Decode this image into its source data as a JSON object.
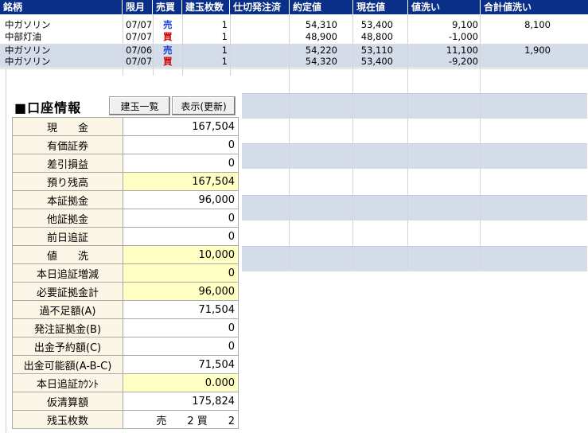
{
  "header": {
    "columns": [
      "銘柄",
      "限月",
      "売買",
      "建玉枚数",
      "仕切発注済",
      "約定値",
      "現在値",
      "値洗い",
      "合計値洗い"
    ]
  },
  "positions": [
    {
      "name": "中ガソリン",
      "month": "07/07",
      "side": "売",
      "side_type": "sell",
      "qty": "1",
      "order": "",
      "fill": "54,310",
      "current": "53,400",
      "mtm": "9,100",
      "total": "8,100"
    },
    {
      "name": "中部灯油",
      "month": "07/07",
      "side": "買",
      "side_type": "buy",
      "qty": "1",
      "order": "",
      "fill": "48,900",
      "current": "48,800",
      "mtm": "-1,000",
      "total": ""
    },
    {
      "name": "中ガソリン",
      "month": "07/06",
      "side": "売",
      "side_type": "sell",
      "qty": "1",
      "order": "",
      "fill": "54,220",
      "current": "53,110",
      "mtm": "11,100",
      "total": "1,900"
    },
    {
      "name": "中ガソリン",
      "month": "07/07",
      "side": "買",
      "side_type": "buy",
      "qty": "1",
      "order": "",
      "fill": "54,320",
      "current": "53,400",
      "mtm": "-9,200",
      "total": ""
    }
  ],
  "account": {
    "title": "■口座情報",
    "buttons": {
      "positions": "建玉一覧",
      "refresh": "表示(更新)"
    },
    "rows": [
      {
        "label": "現　　金",
        "value": "167,504",
        "highlight": false
      },
      {
        "label": "有価証券",
        "value": "0",
        "highlight": false
      },
      {
        "label": "差引損益",
        "value": "0",
        "highlight": false
      },
      {
        "label": "預り残高",
        "value": "167,504",
        "highlight": true
      },
      {
        "label": "本証拠金",
        "value": "96,000",
        "highlight": false
      },
      {
        "label": "他証拠金",
        "value": "0",
        "highlight": false
      },
      {
        "label": "前日追証",
        "value": "0",
        "highlight": false
      },
      {
        "label": "値　　洗",
        "value": "10,000",
        "highlight": true
      },
      {
        "label": "本日追証増減",
        "value": "0",
        "highlight": true
      },
      {
        "label": "必要証拠金計",
        "value": "96,000",
        "highlight": true
      },
      {
        "label": "過不足額(A)",
        "value": "71,504",
        "highlight": false
      },
      {
        "label": "発注証拠金(B)",
        "value": "0",
        "highlight": false
      },
      {
        "label": "出金予約額(C)",
        "value": "0",
        "highlight": false
      },
      {
        "label": "出金可能額(A-B-C)",
        "value": "71,504",
        "highlight": false
      },
      {
        "label": "本日追証ｶｳﾝﾄ",
        "value": "0.000",
        "highlight": true
      },
      {
        "label": "仮清算額",
        "value": "175,824",
        "highlight": false
      },
      {
        "label": "残玉枚数",
        "value": "売　　2 買　　2",
        "highlight": false
      }
    ]
  },
  "colors": {
    "header_bg": "#0a2f88",
    "stripe": "#d3dce8",
    "label_bg": "#fbf5e6",
    "highlight": "#ffffc4",
    "sell": "#1f3fd1",
    "buy": "#d10000"
  }
}
